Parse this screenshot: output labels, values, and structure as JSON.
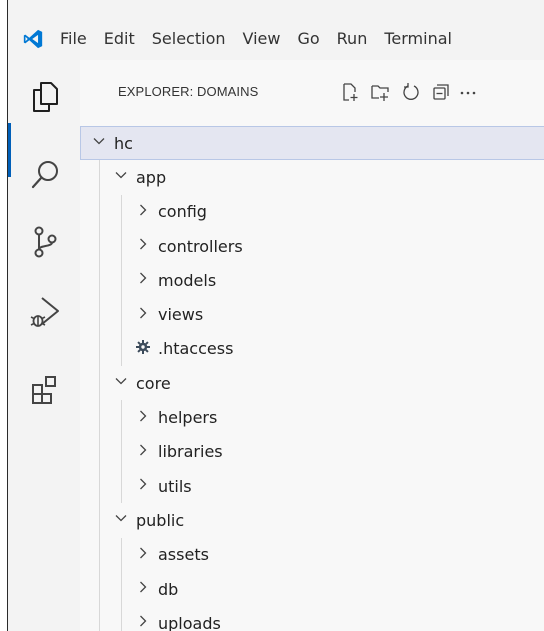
{
  "menu": [
    "File",
    "Edit",
    "Selection",
    "View",
    "Go",
    "Run",
    "Terminal"
  ],
  "explorer": {
    "title": "EXPLORER: DOMAINS"
  },
  "tree": [
    {
      "label": "hc",
      "kind": "folder",
      "expanded": true,
      "depth": 0,
      "selected": true
    },
    {
      "label": "app",
      "kind": "folder",
      "expanded": true,
      "depth": 1
    },
    {
      "label": "config",
      "kind": "folder",
      "expanded": false,
      "depth": 2
    },
    {
      "label": "controllers",
      "kind": "folder",
      "expanded": false,
      "depth": 2
    },
    {
      "label": "models",
      "kind": "folder",
      "expanded": false,
      "depth": 2
    },
    {
      "label": "views",
      "kind": "folder",
      "expanded": false,
      "depth": 2
    },
    {
      "label": ".htaccess",
      "kind": "file",
      "icon": "gear-icon",
      "depth": 2
    },
    {
      "label": "core",
      "kind": "folder",
      "expanded": true,
      "depth": 1
    },
    {
      "label": "helpers",
      "kind": "folder",
      "expanded": false,
      "depth": 2
    },
    {
      "label": "libraries",
      "kind": "folder",
      "expanded": false,
      "depth": 2
    },
    {
      "label": "utils",
      "kind": "folder",
      "expanded": false,
      "depth": 2
    },
    {
      "label": "public",
      "kind": "folder",
      "expanded": true,
      "depth": 1
    },
    {
      "label": "assets",
      "kind": "folder",
      "expanded": false,
      "depth": 2
    },
    {
      "label": "db",
      "kind": "folder",
      "expanded": false,
      "depth": 2
    },
    {
      "label": "uploads",
      "kind": "folder",
      "expanded": false,
      "depth": 2
    }
  ],
  "colors": {
    "accent": "#005fb8",
    "logo": "#0078d4",
    "selected_row": "#e4e6f1"
  }
}
